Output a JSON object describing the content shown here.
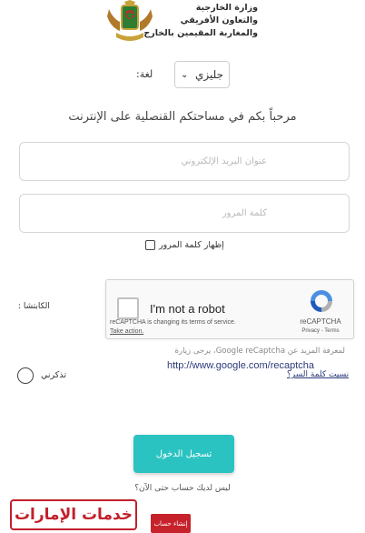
{
  "header": {
    "ministry_line1": "وزارة الخارجية",
    "ministry_line2": "والتعاون الأفريقي",
    "ministry_line3": "والمغاربة المقيمين بالخارج",
    "emblem_icon": "moroccan-coat-of-arms-icon"
  },
  "language": {
    "label": "لغة:",
    "selected": "جليزي",
    "chevron_icon": "chevron-down-icon"
  },
  "welcome_text": "مرحباً بكم في مساحتكم القنصلية على الإنترنت",
  "form": {
    "email_placeholder": "عنوان البريد الإلكتروني",
    "password_placeholder": "كلمة المرور",
    "show_password_label": "إظهار كلمة المرور",
    "captcha_label": "الكابتشا :",
    "remember_label": "تذكرني",
    "forgot_link": "نسيت كلمة السر؟",
    "login_label": "تسجيل الدخول",
    "no_account_text": "ليس لديك حساب حتى الآن؟",
    "create_account_label": "إنشاء حساب"
  },
  "recaptcha": {
    "checkbox_text": "I'm not a robot",
    "notice": "reCAPTCHA is changing its terms of service.",
    "take_action": "Take action.",
    "brand": "reCAPTCHA",
    "terms": "Privacy - Terms",
    "logo_icon": "recaptcha-logo-icon",
    "info_text": "لمعرفة المزيد عن Google reCaptcha، يرجى زيارة",
    "info_link": "http://www.google.com/recaptcha"
  },
  "brand_badge": "خدمات الإمارات",
  "colors": {
    "primary": "#2bc3c2",
    "danger": "#c6222c",
    "link": "#2d3a7a"
  }
}
